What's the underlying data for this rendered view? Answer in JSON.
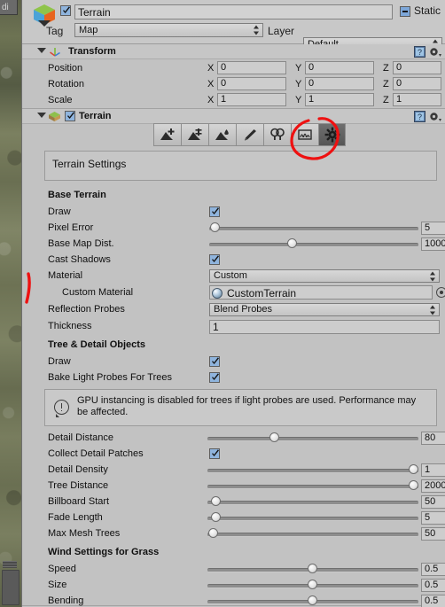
{
  "scene_tab": {
    "label": "di"
  },
  "object_header": {
    "icon": "gameobject-cube-icon",
    "enabled": true,
    "name": "Terrain",
    "static_label": "Static",
    "static_state": "mixed",
    "tag_label": "Tag",
    "tag_value": "Map",
    "layer_label": "Layer",
    "layer_value": "Default"
  },
  "transform": {
    "title": "Transform",
    "rows": [
      {
        "label": "Position",
        "x": "0",
        "y": "0",
        "z": "0"
      },
      {
        "label": "Rotation",
        "x": "0",
        "y": "0",
        "z": "0"
      },
      {
        "label": "Scale",
        "x": "1",
        "y": "1",
        "z": "1"
      }
    ],
    "axis_labels": {
      "x": "X",
      "y": "Y",
      "z": "Z"
    }
  },
  "terrain": {
    "title": "Terrain",
    "enabled": true,
    "toolbar": [
      {
        "name": "raise-lower-terrain-tool",
        "selected": false
      },
      {
        "name": "paint-height-tool",
        "selected": false
      },
      {
        "name": "smooth-height-tool",
        "selected": false
      },
      {
        "name": "paint-texture-tool",
        "selected": false
      },
      {
        "name": "place-trees-tool",
        "selected": false
      },
      {
        "name": "paint-details-tool",
        "selected": false
      },
      {
        "name": "terrain-settings-tool",
        "selected": true
      }
    ],
    "tool_title": "Terrain Settings",
    "base_terrain": {
      "section": "Base Terrain",
      "draw": {
        "label": "Draw",
        "checked": true
      },
      "pixel_error": {
        "label": "Pixel Error",
        "value": "5",
        "percent": 3
      },
      "base_map_dist": {
        "label": "Base Map Dist.",
        "value": "1000",
        "percent": 40
      },
      "cast_shadows": {
        "label": "Cast Shadows",
        "checked": true
      },
      "material": {
        "label": "Material",
        "value": "Custom"
      },
      "custom_material": {
        "label": "Custom Material",
        "value": "CustomTerrain"
      },
      "reflection_probes": {
        "label": "Reflection Probes",
        "value": "Blend Probes"
      },
      "thickness": {
        "label": "Thickness",
        "value": "1"
      }
    },
    "tree_detail": {
      "section": "Tree & Detail Objects",
      "draw": {
        "label": "Draw",
        "checked": true
      },
      "bake_light_probes": {
        "label": "Bake Light Probes For Trees",
        "checked": true
      },
      "info": "GPU instancing is disabled for trees if light probes are used. Performance may be affected.",
      "detail_distance": {
        "label": "Detail Distance",
        "value": "80",
        "percent": 32
      },
      "collect_detail_patches": {
        "label": "Collect Detail Patches",
        "checked": true
      },
      "detail_density": {
        "label": "Detail Density",
        "value": "1",
        "percent": 98
      },
      "tree_distance": {
        "label": "Tree Distance",
        "value": "2000",
        "percent": 98
      },
      "billboard_start": {
        "label": "Billboard Start",
        "value": "50",
        "percent": 4
      },
      "fade_length": {
        "label": "Fade Length",
        "value": "5",
        "percent": 4
      },
      "max_mesh_trees": {
        "label": "Max Mesh Trees",
        "value": "50",
        "percent": 3
      }
    },
    "wind": {
      "section": "Wind Settings for Grass",
      "speed": {
        "label": "Speed",
        "value": "0.5",
        "percent": 50
      },
      "size": {
        "label": "Size",
        "value": "0.5",
        "percent": 50
      },
      "bending": {
        "label": "Bending",
        "value": "0.5",
        "percent": 50
      }
    }
  },
  "annotations": {
    "color": "#ee1111",
    "circle_target": "terrain-settings-tool",
    "stroke_target": "material-rows"
  }
}
